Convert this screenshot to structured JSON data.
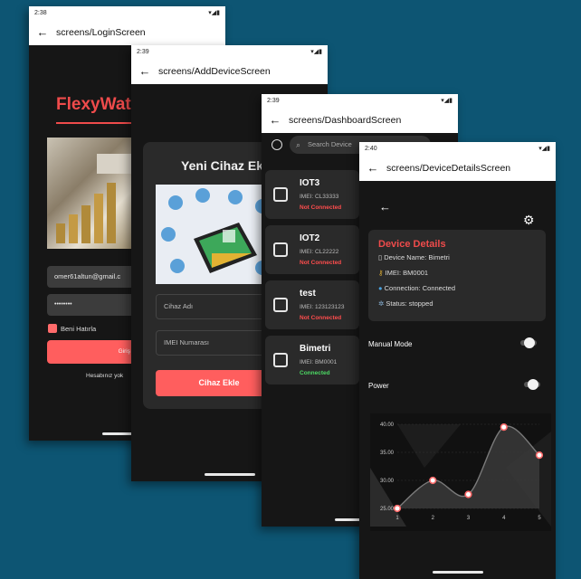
{
  "login": {
    "status_time": "2:38",
    "title": "screens/LoginScreen",
    "brand": "FlexyWat",
    "email": "omer61altun@gmail.c",
    "password": "••••••••",
    "remember": "Beni Hatırla",
    "login_button": "Giriş",
    "signup_text": "Hesabınız yok"
  },
  "add_device": {
    "status_time": "2:39",
    "title": "screens/AddDeviceScreen",
    "heading": "Yeni Cihaz Ek",
    "name_placeholder": "Cihaz Adı",
    "imei_placeholder": "IMEI Numarası",
    "submit": "Cihaz Ekle"
  },
  "dashboard": {
    "status_time": "2:39",
    "title": "screens/DashboardScreen",
    "search_placeholder": "Search Device",
    "devices": [
      {
        "name": "IOT3",
        "imei": "IMEI: CL33333",
        "status": "Not Connected",
        "status_color": "#ff4d4d"
      },
      {
        "name": "IOT2",
        "imei": "IMEI: CL22222",
        "status": "Not Connected",
        "status_color": "#ff4d4d"
      },
      {
        "name": "test",
        "imei": "IMEI: 123123123",
        "status": "Not Connected",
        "status_color": "#ff4d4d"
      },
      {
        "name": "Bimetri",
        "imei": "IMEI: BM0001",
        "status": "Connected",
        "status_color": "#4cd964"
      }
    ]
  },
  "details": {
    "status_time": "2:40",
    "title": "screens/DeviceDetailsScreen",
    "card_title": "Device Details",
    "device_name": "Device Name: Bimetri",
    "imei": "IMEI: BM0001",
    "connection": "Connection: Connected",
    "status": "Status: stopped",
    "manual_mode": "Manual Mode",
    "power": "Power"
  },
  "chart_data": {
    "type": "area",
    "x": [
      1,
      2,
      3,
      4,
      5
    ],
    "values": [
      25,
      30,
      27.5,
      39.5,
      34.5
    ],
    "ylim": [
      25,
      40
    ],
    "yticks": [
      "40.00",
      "35.00",
      "30.00",
      "25.00"
    ],
    "xticks": [
      "1",
      "2",
      "3",
      "4",
      "5"
    ],
    "line_color": "#7a7a7a",
    "point_color": "#ff6b6b"
  }
}
